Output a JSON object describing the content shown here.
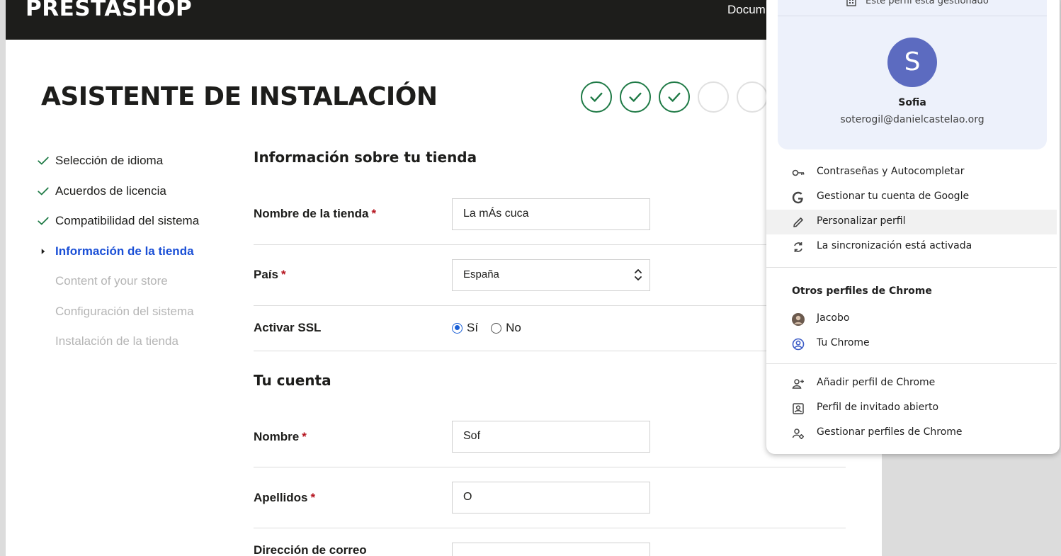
{
  "header": {
    "logo": "PRESTASHOP",
    "nav_partial": "Docum"
  },
  "wizard": {
    "title": "ASISTENTE DE INSTALACIÓN",
    "steps_done": 3,
    "steps_total": 5
  },
  "sidebar": {
    "items": [
      {
        "label": "Selección de idioma",
        "state": "done"
      },
      {
        "label": "Acuerdos de licencia",
        "state": "done"
      },
      {
        "label": "Compatibilidad del sistema",
        "state": "done"
      },
      {
        "label": "Información de la tienda",
        "state": "active"
      },
      {
        "label": "Content of your store",
        "state": "todo"
      },
      {
        "label": "Configuración del sistema",
        "state": "todo"
      },
      {
        "label": "Instalación de la tienda",
        "state": "todo"
      }
    ]
  },
  "store_section": {
    "title": "Información sobre tu tienda",
    "store_name": {
      "label": "Nombre de la tienda",
      "required": "*",
      "value": "La mÁs cuca"
    },
    "country": {
      "label": "País",
      "required": "*",
      "value": "España"
    },
    "ssl": {
      "label": "Activar SSL",
      "yes": "Sí",
      "no": "No",
      "selected": "yes"
    }
  },
  "account_section": {
    "title": "Tu cuenta",
    "first_name": {
      "label": "Nombre",
      "required": "*",
      "value": "Sof"
    },
    "last_name": {
      "label": "Apellidos",
      "required": "*",
      "value": "O"
    },
    "email": {
      "label": "Dirección de correo",
      "value": ""
    }
  },
  "profile_popup": {
    "managed_text": "Este perfil está gestionado",
    "avatar_letter": "S",
    "name": "Sofia",
    "email": "soterogil@danielcastelao.org",
    "menu": [
      {
        "label": "Contraseñas y Autocompletar",
        "icon": "key-icon"
      },
      {
        "label": "Gestionar tu cuenta de Google",
        "icon": "google-icon"
      },
      {
        "label": "Personalizar perfil",
        "icon": "pencil-icon"
      },
      {
        "label": "La sincronización está activada",
        "icon": "sync-icon"
      }
    ],
    "other_profiles_title": "Otros perfiles de Chrome",
    "other_profiles": [
      {
        "label": "Jacobo",
        "icon": "profile-photo-icon"
      },
      {
        "label": "Tu Chrome",
        "icon": "account-circle-icon"
      }
    ],
    "footer_menu": [
      {
        "label": "Añadir perfil de Chrome",
        "icon": "add-person-icon"
      },
      {
        "label": "Perfil de invitado abierto",
        "icon": "guest-icon"
      },
      {
        "label": "Gestionar perfiles de Chrome",
        "icon": "manage-profiles-icon"
      }
    ]
  },
  "colors": {
    "topbar": "#1d1d1b",
    "success_green": "#1f7a46",
    "active_blue": "#1a4fd6",
    "required_red": "#b5141f",
    "avatar_bg": "#5c6bc0",
    "popup_card_bg": "#edf1fb"
  }
}
